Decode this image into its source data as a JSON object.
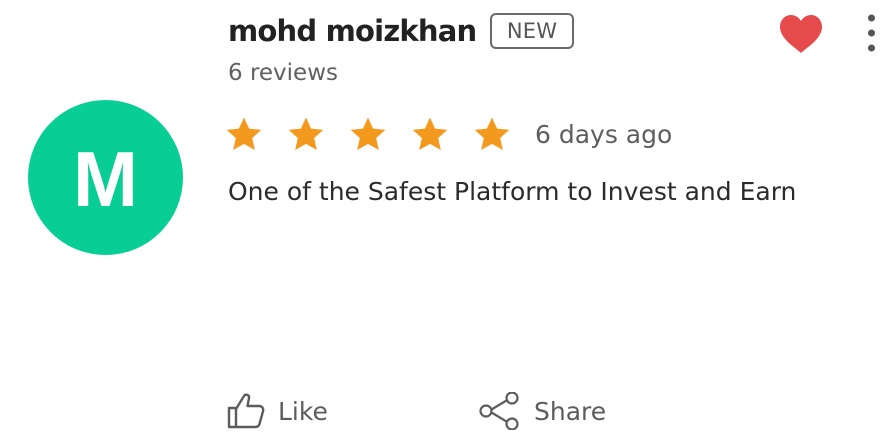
{
  "review": {
    "avatar": {
      "letter": "M",
      "color": "#08cd94"
    },
    "reviewer_name": "mohd moizkhan",
    "badge": "NEW",
    "review_count": "6 reviews",
    "rating": 5,
    "rating_max": 5,
    "star_color": "#f39a1e",
    "date": "6 days ago",
    "text": "One of the Safest Platform to Invest and Earn"
  },
  "icons": {
    "favorite": {
      "name": "heart-icon",
      "color": "#e54b4b",
      "filled": true
    },
    "menu": "more-vertical-icon",
    "like": "thumbs-up-icon",
    "share": "share-icon"
  },
  "actions": {
    "like_label": "Like",
    "share_label": "Share"
  }
}
